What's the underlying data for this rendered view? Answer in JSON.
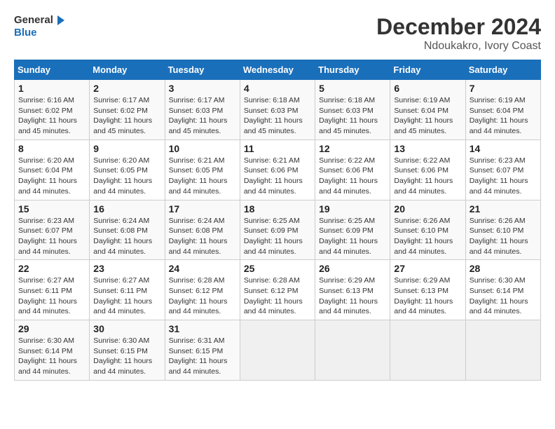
{
  "logo": {
    "text_general": "General",
    "text_blue": "Blue"
  },
  "title": "December 2024",
  "subtitle": "Ndoukakro, Ivory Coast",
  "weekdays": [
    "Sunday",
    "Monday",
    "Tuesday",
    "Wednesday",
    "Thursday",
    "Friday",
    "Saturday"
  ],
  "weeks": [
    [
      {
        "day": 1,
        "info": "Sunrise: 6:16 AM\nSunset: 6:02 PM\nDaylight: 11 hours\nand 45 minutes."
      },
      {
        "day": 2,
        "info": "Sunrise: 6:17 AM\nSunset: 6:02 PM\nDaylight: 11 hours\nand 45 minutes."
      },
      {
        "day": 3,
        "info": "Sunrise: 6:17 AM\nSunset: 6:03 PM\nDaylight: 11 hours\nand 45 minutes."
      },
      {
        "day": 4,
        "info": "Sunrise: 6:18 AM\nSunset: 6:03 PM\nDaylight: 11 hours\nand 45 minutes."
      },
      {
        "day": 5,
        "info": "Sunrise: 6:18 AM\nSunset: 6:03 PM\nDaylight: 11 hours\nand 45 minutes."
      },
      {
        "day": 6,
        "info": "Sunrise: 6:19 AM\nSunset: 6:04 PM\nDaylight: 11 hours\nand 45 minutes."
      },
      {
        "day": 7,
        "info": "Sunrise: 6:19 AM\nSunset: 6:04 PM\nDaylight: 11 hours\nand 44 minutes."
      }
    ],
    [
      {
        "day": 8,
        "info": "Sunrise: 6:20 AM\nSunset: 6:04 PM\nDaylight: 11 hours\nand 44 minutes."
      },
      {
        "day": 9,
        "info": "Sunrise: 6:20 AM\nSunset: 6:05 PM\nDaylight: 11 hours\nand 44 minutes."
      },
      {
        "day": 10,
        "info": "Sunrise: 6:21 AM\nSunset: 6:05 PM\nDaylight: 11 hours\nand 44 minutes."
      },
      {
        "day": 11,
        "info": "Sunrise: 6:21 AM\nSunset: 6:06 PM\nDaylight: 11 hours\nand 44 minutes."
      },
      {
        "day": 12,
        "info": "Sunrise: 6:22 AM\nSunset: 6:06 PM\nDaylight: 11 hours\nand 44 minutes."
      },
      {
        "day": 13,
        "info": "Sunrise: 6:22 AM\nSunset: 6:06 PM\nDaylight: 11 hours\nand 44 minutes."
      },
      {
        "day": 14,
        "info": "Sunrise: 6:23 AM\nSunset: 6:07 PM\nDaylight: 11 hours\nand 44 minutes."
      }
    ],
    [
      {
        "day": 15,
        "info": "Sunrise: 6:23 AM\nSunset: 6:07 PM\nDaylight: 11 hours\nand 44 minutes."
      },
      {
        "day": 16,
        "info": "Sunrise: 6:24 AM\nSunset: 6:08 PM\nDaylight: 11 hours\nand 44 minutes."
      },
      {
        "day": 17,
        "info": "Sunrise: 6:24 AM\nSunset: 6:08 PM\nDaylight: 11 hours\nand 44 minutes."
      },
      {
        "day": 18,
        "info": "Sunrise: 6:25 AM\nSunset: 6:09 PM\nDaylight: 11 hours\nand 44 minutes."
      },
      {
        "day": 19,
        "info": "Sunrise: 6:25 AM\nSunset: 6:09 PM\nDaylight: 11 hours\nand 44 minutes."
      },
      {
        "day": 20,
        "info": "Sunrise: 6:26 AM\nSunset: 6:10 PM\nDaylight: 11 hours\nand 44 minutes."
      },
      {
        "day": 21,
        "info": "Sunrise: 6:26 AM\nSunset: 6:10 PM\nDaylight: 11 hours\nand 44 minutes."
      }
    ],
    [
      {
        "day": 22,
        "info": "Sunrise: 6:27 AM\nSunset: 6:11 PM\nDaylight: 11 hours\nand 44 minutes."
      },
      {
        "day": 23,
        "info": "Sunrise: 6:27 AM\nSunset: 6:11 PM\nDaylight: 11 hours\nand 44 minutes."
      },
      {
        "day": 24,
        "info": "Sunrise: 6:28 AM\nSunset: 6:12 PM\nDaylight: 11 hours\nand 44 minutes."
      },
      {
        "day": 25,
        "info": "Sunrise: 6:28 AM\nSunset: 6:12 PM\nDaylight: 11 hours\nand 44 minutes."
      },
      {
        "day": 26,
        "info": "Sunrise: 6:29 AM\nSunset: 6:13 PM\nDaylight: 11 hours\nand 44 minutes."
      },
      {
        "day": 27,
        "info": "Sunrise: 6:29 AM\nSunset: 6:13 PM\nDaylight: 11 hours\nand 44 minutes."
      },
      {
        "day": 28,
        "info": "Sunrise: 6:30 AM\nSunset: 6:14 PM\nDaylight: 11 hours\nand 44 minutes."
      }
    ],
    [
      {
        "day": 29,
        "info": "Sunrise: 6:30 AM\nSunset: 6:14 PM\nDaylight: 11 hours\nand 44 minutes."
      },
      {
        "day": 30,
        "info": "Sunrise: 6:30 AM\nSunset: 6:15 PM\nDaylight: 11 hours\nand 44 minutes."
      },
      {
        "day": 31,
        "info": "Sunrise: 6:31 AM\nSunset: 6:15 PM\nDaylight: 11 hours\nand 44 minutes."
      },
      null,
      null,
      null,
      null
    ]
  ]
}
